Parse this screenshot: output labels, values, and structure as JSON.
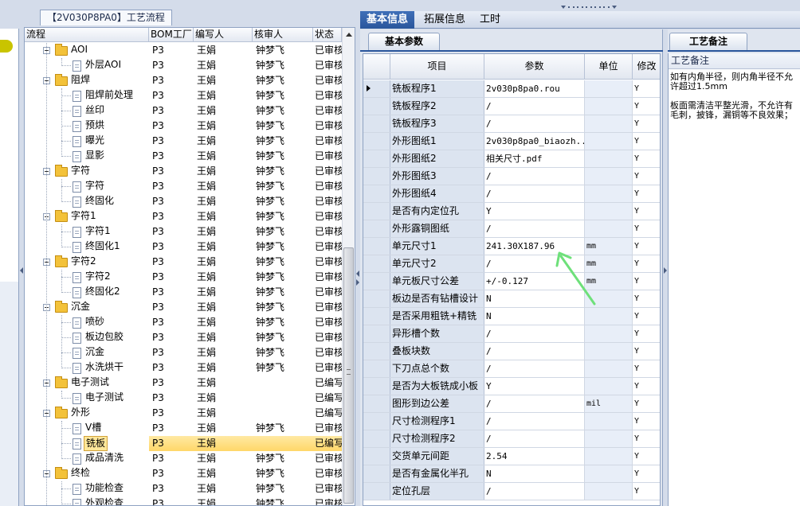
{
  "tree": {
    "title": "【2V030P8PA0】工艺流程",
    "columns": [
      "流程",
      "BOM工厂",
      "编写人",
      "核审人",
      "状态"
    ],
    "rows": [
      {
        "label": "AOI",
        "level": 0,
        "bom": "P3",
        "writer": "王娟",
        "reviewer": "钟梦飞",
        "status": "已审核"
      },
      {
        "label": "外层AOI",
        "level": 1,
        "bom": "P3",
        "writer": "王娟",
        "reviewer": "钟梦飞",
        "status": "已审核"
      },
      {
        "label": "阻焊",
        "level": 0,
        "bom": "P3",
        "writer": "王娟",
        "reviewer": "钟梦飞",
        "status": "已审核"
      },
      {
        "label": "阻焊前处理",
        "level": 1,
        "bom": "P3",
        "writer": "王娟",
        "reviewer": "钟梦飞",
        "status": "已审核"
      },
      {
        "label": "丝印",
        "level": 1,
        "bom": "P3",
        "writer": "王娟",
        "reviewer": "钟梦飞",
        "status": "已审核"
      },
      {
        "label": "预烘",
        "level": 1,
        "bom": "P3",
        "writer": "王娟",
        "reviewer": "钟梦飞",
        "status": "已审核"
      },
      {
        "label": "曝光",
        "level": 1,
        "bom": "P3",
        "writer": "王娟",
        "reviewer": "钟梦飞",
        "status": "已审核"
      },
      {
        "label": "显影",
        "level": 1,
        "bom": "P3",
        "writer": "王娟",
        "reviewer": "钟梦飞",
        "status": "已审核"
      },
      {
        "label": "字符",
        "level": 0,
        "bom": "P3",
        "writer": "王娟",
        "reviewer": "钟梦飞",
        "status": "已审核"
      },
      {
        "label": "字符",
        "level": 1,
        "bom": "P3",
        "writer": "王娟",
        "reviewer": "钟梦飞",
        "status": "已审核"
      },
      {
        "label": "终固化",
        "level": 1,
        "bom": "P3",
        "writer": "王娟",
        "reviewer": "钟梦飞",
        "status": "已审核"
      },
      {
        "label": "字符1",
        "level": 0,
        "bom": "P3",
        "writer": "王娟",
        "reviewer": "钟梦飞",
        "status": "已审核"
      },
      {
        "label": "字符1",
        "level": 1,
        "bom": "P3",
        "writer": "王娟",
        "reviewer": "钟梦飞",
        "status": "已审核"
      },
      {
        "label": "终固化1",
        "level": 1,
        "bom": "P3",
        "writer": "王娟",
        "reviewer": "钟梦飞",
        "status": "已审核"
      },
      {
        "label": "字符2",
        "level": 0,
        "bom": "P3",
        "writer": "王娟",
        "reviewer": "钟梦飞",
        "status": "已审核"
      },
      {
        "label": "字符2",
        "level": 1,
        "bom": "P3",
        "writer": "王娟",
        "reviewer": "钟梦飞",
        "status": "已审核"
      },
      {
        "label": "终固化2",
        "level": 1,
        "bom": "P3",
        "writer": "王娟",
        "reviewer": "钟梦飞",
        "status": "已审核"
      },
      {
        "label": "沉金",
        "level": 0,
        "bom": "P3",
        "writer": "王娟",
        "reviewer": "钟梦飞",
        "status": "已审核"
      },
      {
        "label": "喷砂",
        "level": 1,
        "bom": "P3",
        "writer": "王娟",
        "reviewer": "钟梦飞",
        "status": "已审核"
      },
      {
        "label": "板边包胶",
        "level": 1,
        "bom": "P3",
        "writer": "王娟",
        "reviewer": "钟梦飞",
        "status": "已审核"
      },
      {
        "label": "沉金",
        "level": 1,
        "bom": "P3",
        "writer": "王娟",
        "reviewer": "钟梦飞",
        "status": "已审核"
      },
      {
        "label": "水洗烘干",
        "level": 1,
        "bom": "P3",
        "writer": "王娟",
        "reviewer": "钟梦飞",
        "status": "已审核"
      },
      {
        "label": "电子测试",
        "level": 0,
        "bom": "P3",
        "writer": "王娟",
        "reviewer": "",
        "status": "已编写"
      },
      {
        "label": "电子测试",
        "level": 1,
        "bom": "P3",
        "writer": "王娟",
        "reviewer": "",
        "status": "已编写"
      },
      {
        "label": "外形",
        "level": 0,
        "bom": "P3",
        "writer": "王娟",
        "reviewer": "",
        "status": "已编写"
      },
      {
        "label": "V槽",
        "level": 1,
        "bom": "P3",
        "writer": "王娟",
        "reviewer": "钟梦飞",
        "status": "已审核"
      },
      {
        "label": "铣板",
        "level": 1,
        "bom": "P3",
        "writer": "王娟",
        "reviewer": "",
        "status": "已编写",
        "selected": true
      },
      {
        "label": "成品清洗",
        "level": 1,
        "bom": "P3",
        "writer": "王娟",
        "reviewer": "钟梦飞",
        "status": "已审核"
      },
      {
        "label": "终检",
        "level": 0,
        "bom": "P3",
        "writer": "王娟",
        "reviewer": "钟梦飞",
        "status": "已审核"
      },
      {
        "label": "功能检查",
        "level": 1,
        "bom": "P3",
        "writer": "王娟",
        "reviewer": "钟梦飞",
        "status": "已审核"
      },
      {
        "label": "外观检查",
        "level": 1,
        "bom": "P3",
        "writer": "王娟",
        "reviewer": "钟梦飞",
        "status": "已审核"
      }
    ]
  },
  "tabs": [
    {
      "label": "基本信息",
      "active": true
    },
    {
      "label": "拓展信息",
      "active": false
    },
    {
      "label": "工时",
      "active": false
    }
  ],
  "params": {
    "subtab": "基本参数",
    "columns": [
      "项目",
      "参数",
      "单位",
      "修改"
    ],
    "rows": [
      {
        "item": "铣板程序1",
        "value": "2v030p8pa0.rou",
        "unit": "",
        "mod": "Y",
        "current": true
      },
      {
        "item": "铣板程序2",
        "value": "/",
        "unit": "",
        "mod": "Y"
      },
      {
        "item": "铣板程序3",
        "value": "/",
        "unit": "",
        "mod": "Y"
      },
      {
        "item": "外形图纸1",
        "value": "2v030p8pa0_biaozh...",
        "unit": "",
        "mod": "Y"
      },
      {
        "item": "外形图纸2",
        "value": "相关尺寸.pdf",
        "unit": "",
        "mod": "Y"
      },
      {
        "item": "外形图纸3",
        "value": "/",
        "unit": "",
        "mod": "Y"
      },
      {
        "item": "外形图纸4",
        "value": "/",
        "unit": "",
        "mod": "Y"
      },
      {
        "item": "是否有内定位孔",
        "value": "Y",
        "unit": "",
        "mod": "Y"
      },
      {
        "item": "外形露铜图纸",
        "value": "/",
        "unit": "",
        "mod": "Y"
      },
      {
        "item": "单元尺寸1",
        "value": "241.30X187.96",
        "unit": "mm",
        "mod": "Y"
      },
      {
        "item": "单元尺寸2",
        "value": "/",
        "unit": "mm",
        "mod": "Y"
      },
      {
        "item": "单元板尺寸公差",
        "value": "+/-0.127",
        "unit": "mm",
        "mod": "Y"
      },
      {
        "item": "板边是否有钻槽设计",
        "value": "N",
        "unit": "",
        "mod": "Y"
      },
      {
        "item": "是否采用粗铣+精铣",
        "value": "N",
        "unit": "",
        "mod": "Y"
      },
      {
        "item": "异形槽个数",
        "value": "/",
        "unit": "",
        "mod": "Y"
      },
      {
        "item": "叠板块数",
        "value": "/",
        "unit": "",
        "mod": "Y"
      },
      {
        "item": "下刀点总个数",
        "value": "/",
        "unit": "",
        "mod": "Y"
      },
      {
        "item": "是否为大板铣成小板",
        "value": "Y",
        "unit": "",
        "mod": "Y"
      },
      {
        "item": "图形到边公差",
        "value": "/",
        "unit": "mil",
        "mod": "Y"
      },
      {
        "item": "尺寸检测程序1",
        "value": "/",
        "unit": "",
        "mod": "Y"
      },
      {
        "item": "尺寸检测程序2",
        "value": "/",
        "unit": "",
        "mod": "Y"
      },
      {
        "item": "交货单元间距",
        "value": "2.54",
        "unit": "",
        "mod": "Y"
      },
      {
        "item": "是否有金属化半孔",
        "value": "N",
        "unit": "",
        "mod": "Y"
      },
      {
        "item": "定位孔层",
        "value": "/",
        "unit": "",
        "mod": "Y"
      }
    ]
  },
  "notes": {
    "tab": "工艺备注",
    "label": "工艺备注",
    "text": "如有内角半径，则内角半径不允\n许超过1.5mm\n\n板面需清洁平整光滑，不允许有\n毛刺，披锋，漏铜等不良效果；"
  },
  "colors": {
    "accent": "#2a569c",
    "selected_row": "#ffd768",
    "annotation_arrow": "#6ee07a"
  },
  "icons": [
    "folder-icon",
    "document-icon",
    "collapse-icon",
    "row-pointer-icon",
    "scroll-up-icon",
    "annotation-arrow-icon"
  ]
}
